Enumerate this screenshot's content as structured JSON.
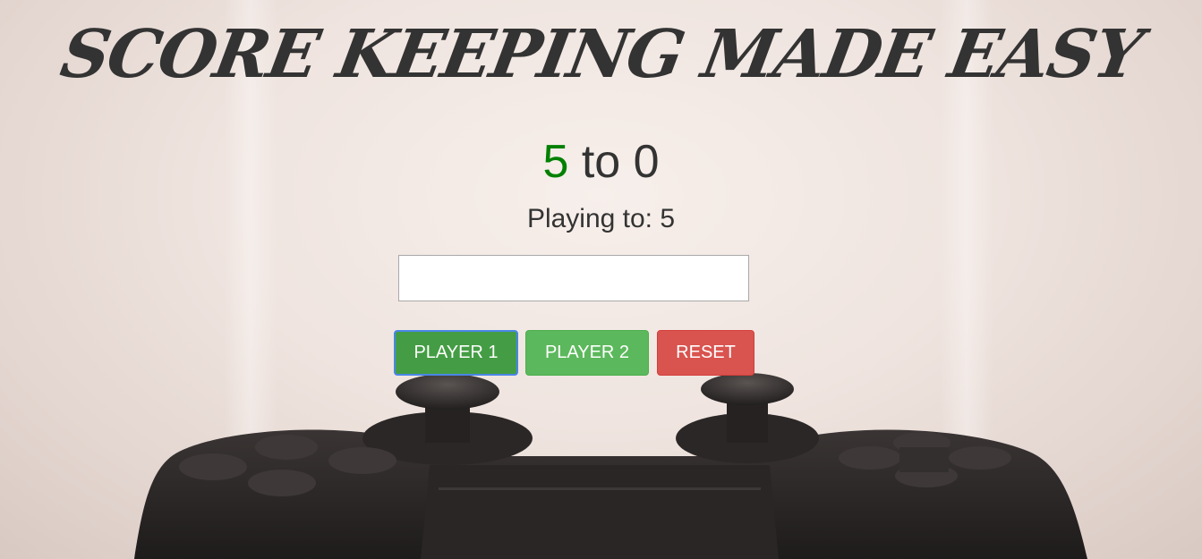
{
  "header": {
    "title": "SCORE KEEPING MADE EASY"
  },
  "score": {
    "player1": "5",
    "separator": "to",
    "player2": "0",
    "player1_color": "#008000"
  },
  "settings": {
    "playing_to_label": "Playing to: 5",
    "limit_input_value": ""
  },
  "buttons": {
    "player1_label": "PLAYER 1",
    "player2_label": "PLAYER 2",
    "reset_label": "RESET"
  },
  "colors": {
    "player1_button": "#449d44",
    "player2_button": "#5cb85c",
    "reset_button": "#d9534f",
    "focus_outline": "#4a86e8"
  },
  "background": {
    "image": "gamepad-controller-photo"
  }
}
